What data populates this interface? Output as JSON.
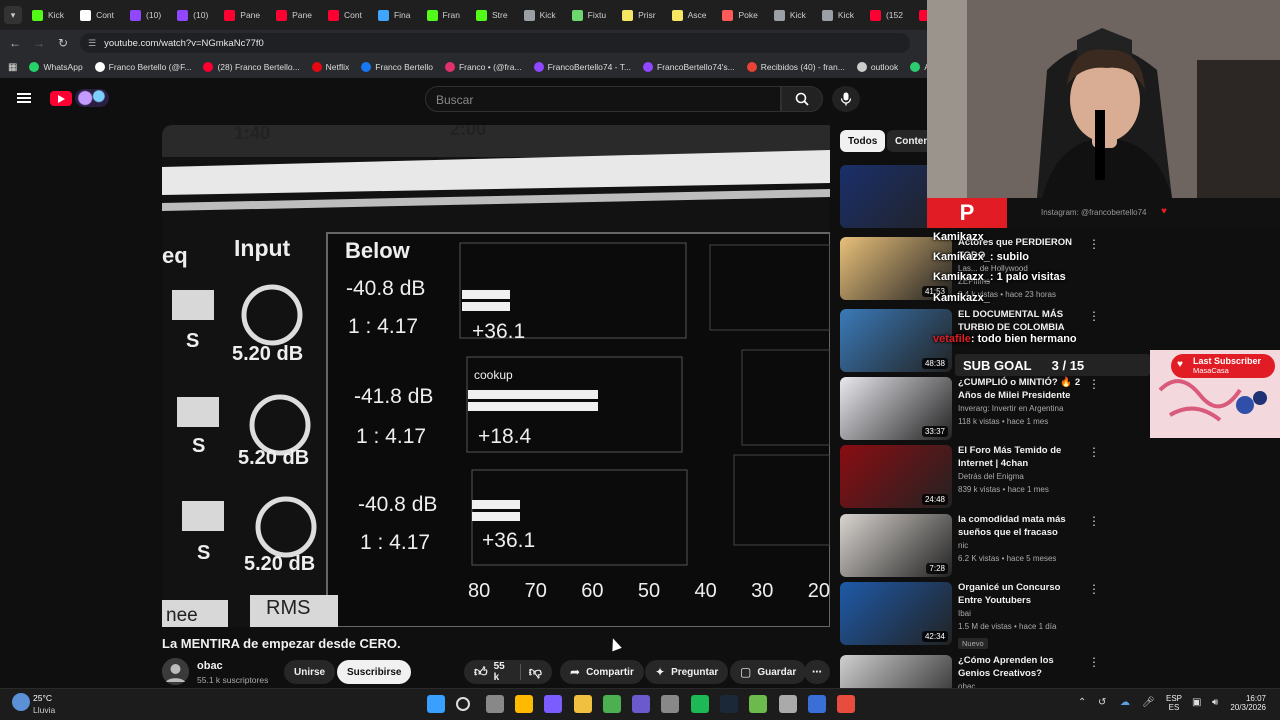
{
  "browser": {
    "tabs": [
      {
        "label": "Kick",
        "color": "#53fc18"
      },
      {
        "label": "Cont",
        "color": "#ffffff"
      },
      {
        "label": "(10)",
        "color": "#9146ff"
      },
      {
        "label": "(10)",
        "color": "#9146ff"
      },
      {
        "label": "Pane",
        "color": "#ff0033"
      },
      {
        "label": "Pane",
        "color": "#ff0033"
      },
      {
        "label": "Cont",
        "color": "#ff0033"
      },
      {
        "label": "Fina",
        "color": "#3ea6ff"
      },
      {
        "label": "Fran",
        "color": "#53fc18"
      },
      {
        "label": "Stre",
        "color": "#53fc18"
      },
      {
        "label": "Kick",
        "color": "#9aa0a6"
      },
      {
        "label": "Fixtu",
        "color": "#6dd66d"
      },
      {
        "label": "Prisr",
        "color": "#f5e663"
      },
      {
        "label": "Asce",
        "color": "#f5e663"
      },
      {
        "label": "Poke",
        "color": "#ff5a5a"
      },
      {
        "label": "Kick",
        "color": "#9aa0a6"
      },
      {
        "label": "Kick",
        "color": "#9aa0a6"
      },
      {
        "label": "(152",
        "color": "#ff0033"
      },
      {
        "label": "(15",
        "color": "#ff0033"
      }
    ],
    "url": "youtube.com/watch?v=NGmkaNc77f0",
    "bookmarks": [
      {
        "label": "WhatsApp",
        "color": "#25d366"
      },
      {
        "label": "Franco Bertello (@F...",
        "color": "#ffffff"
      },
      {
        "label": "(28) Franco Bertello...",
        "color": "#ff0033"
      },
      {
        "label": "Netflix",
        "color": "#e50914"
      },
      {
        "label": "Franco Bertello",
        "color": "#1877f2"
      },
      {
        "label": "Franco • (@fra...",
        "color": "#e1306c"
      },
      {
        "label": "FrancoBertello74 - T...",
        "color": "#9146ff"
      },
      {
        "label": "FrancoBertello74's...",
        "color": "#9146ff"
      },
      {
        "label": "Recibidos (40) - fran...",
        "color": "#ea4335"
      },
      {
        "label": "outlook",
        "color": "#cccccc"
      },
      {
        "label": "Aler",
        "color": "#2ecc71"
      }
    ]
  },
  "youtube": {
    "search_placeholder": "Buscar",
    "chips": [
      "Todos",
      "Contenid"
    ],
    "video": {
      "title": "La MENTIRA de empezar desde CERO.",
      "channel": "obac",
      "subscribers": "55.1 k suscriptores",
      "join": "Unirse",
      "subscribe": "Suscribirse",
      "likes": "55 k",
      "share": "Compartir",
      "ask": "Preguntar",
      "save": "Guardar"
    },
    "player_text": {
      "t1": "1:40",
      "t2": "2:00",
      "eq": "eq",
      "input": "Input",
      "below": "Below",
      "db1": "-40.8 dB",
      "r1": "1 : 4.17",
      "v1": "+36.1",
      "db2": "-41.8 dB",
      "r2": "1 : 4.17",
      "v2": "+18.4",
      "db3": "-40.8 dB",
      "r3": "1 : 4.17",
      "v3": "+36.1",
      "k1": "5.20 dB",
      "k2": "5.20 dB",
      "k3": "5.20 dB",
      "s": "S",
      "cookup": "cookup",
      "nee": "nee",
      "rms": "RMS",
      "scale": [
        "80",
        "70",
        "60",
        "50",
        "40",
        "30",
        "20"
      ]
    },
    "sidebar": [
      {
        "title": "",
        "channel": "",
        "meta": "",
        "duration": ""
      },
      {
        "title": "Actores que PERDIERON TODO",
        "channel": "Las... de Hollywood",
        "meta": "ZEPfilms",
        "meta2": "8.4 k vistas • hace 23 horas",
        "duration": "41:53"
      },
      {
        "title": "EL DOCUMENTAL MÁS TURBIO DE COLOMBIA",
        "channel": "",
        "meta": "",
        "meta2": "",
        "duration": "48:38"
      },
      {
        "title": "¿CUMPLIÓ o MINTIÓ? 🔥 2 Años de Milei Presidente",
        "channel": "Inverarg: Invertir en Argentina",
        "meta": "118 k vistas • hace 1 mes",
        "duration": "33:37"
      },
      {
        "title": "El Foro Más Temido de Internet | 4chan",
        "channel": "Detrás del Enigma",
        "meta": "839 k vistas • hace 1 mes",
        "duration": "24:48"
      },
      {
        "title": "la comodidad mata más sueños que el fracaso",
        "channel": "nic",
        "meta": "6.2 K vistas • hace 5 meses",
        "duration": "7:28"
      },
      {
        "title": "Organicé un Concurso Entre Youtubers",
        "channel": "Ibai",
        "meta": "1.5 M de vistas • hace 1 día",
        "badge": "Nuevo",
        "duration": "42:34"
      },
      {
        "title": "¿Cómo Aprenden los Genios Creativos?",
        "channel": "obac",
        "meta": "",
        "duration": ""
      }
    ]
  },
  "stream_overlay": {
    "logo": "P",
    "instagram": "Instagram: @francobertello74",
    "chat": [
      {
        "user": "Kamikazx_",
        "msg": ""
      },
      {
        "user": "Kamikazx_",
        "msg": ": subilo"
      },
      {
        "user": "Kamikazx_",
        "msg": ": 1 palo visitas"
      },
      {
        "user": "Kamikazx_",
        "msg": ""
      },
      {
        "user": "vetafile",
        "msg": ": todo bien hermano"
      }
    ],
    "sub_goal_label": "SUB GOAL",
    "sub_goal_value": "3 / 15",
    "last_sub_title": "Last Subscriber",
    "last_sub_name": "MasaCasa"
  },
  "taskbar": {
    "weather_temp": "25°C",
    "weather_desc": "Lluvia",
    "lang1": "ESP",
    "lang2": "ES",
    "time": "16:07",
    "date": "20/3/2026"
  }
}
